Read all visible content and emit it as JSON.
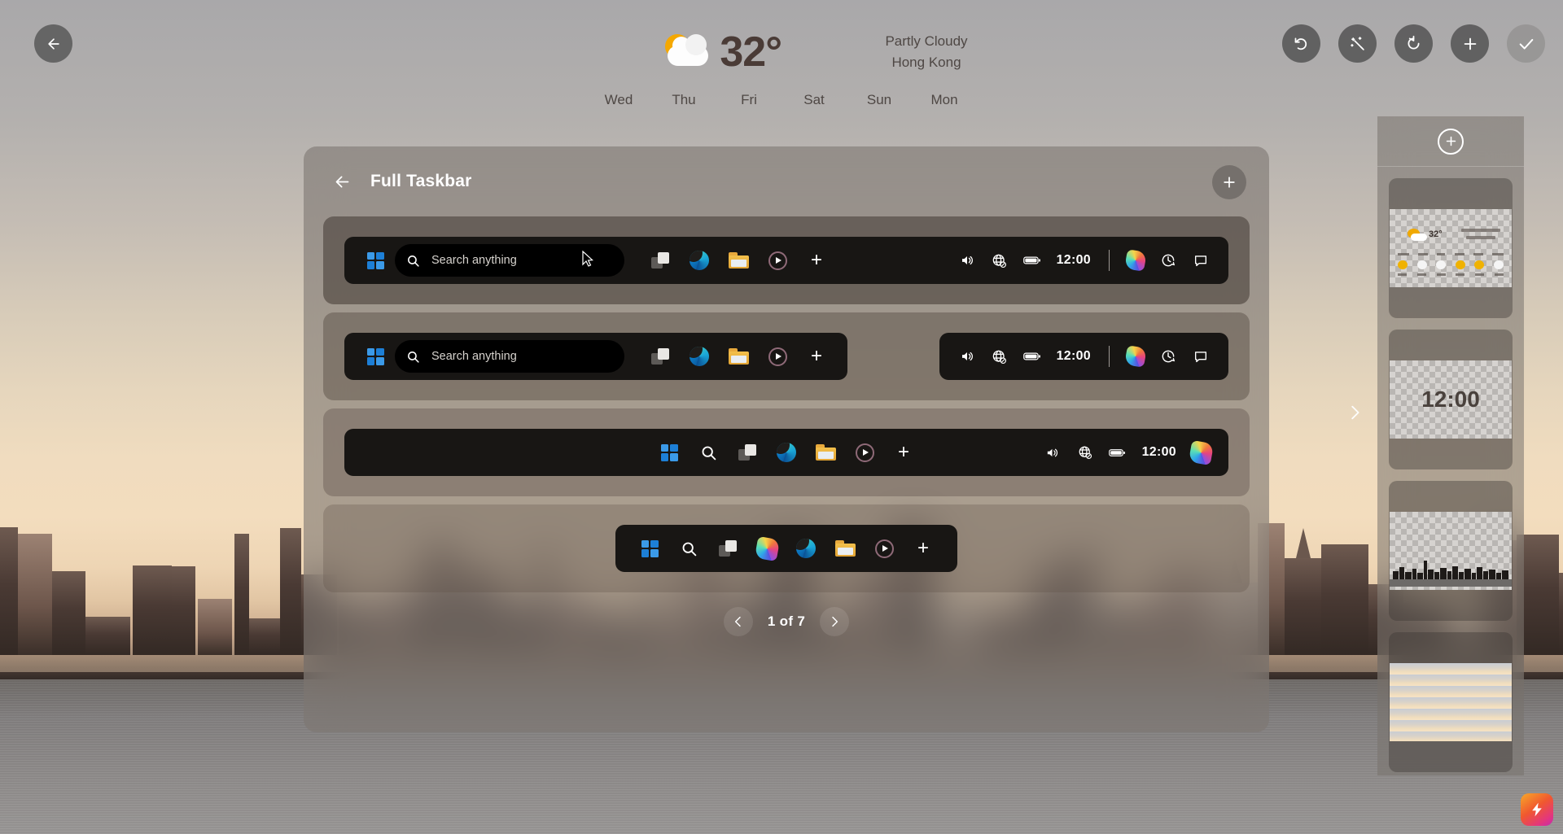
{
  "nav": {
    "back_label": "←",
    "back_name": "back-arrow-icon"
  },
  "toolbar": {
    "undo_label": "↩",
    "magic_label": "✦",
    "reset_label": "↻",
    "add_label": "+",
    "accept_label": "✓"
  },
  "weather": {
    "temperature": "32°",
    "condition": "Partly Cloudy",
    "location": "Hong Kong",
    "days": [
      "Wed",
      "Thu",
      "Fri",
      "Sat",
      "Sun",
      "Mon"
    ]
  },
  "panel": {
    "title": "Full Taskbar",
    "back_label": "←",
    "add_label": "+",
    "pagination": {
      "prev_label": "‹",
      "next_label": "›",
      "label": "1 of 7",
      "current": 1,
      "total": 7
    },
    "rows": [
      {
        "name": "taskbar-variant-full-left-aligned",
        "search_placeholder": "Search anything",
        "time": "12:00",
        "apps": [
          "task-view",
          "edge",
          "file-explorer",
          "media-player",
          "add"
        ],
        "tray": [
          "volume",
          "network",
          "battery"
        ],
        "tray_extra": [
          "copilot",
          "clock-history",
          "chat"
        ]
      },
      {
        "name": "taskbar-variant-split-bars",
        "search_placeholder": "Search anything",
        "time": "12:00",
        "apps": [
          "task-view",
          "edge",
          "file-explorer",
          "media-player",
          "add"
        ],
        "tray": [
          "volume",
          "network",
          "battery"
        ],
        "tray_extra": [
          "copilot",
          "clock-history",
          "chat"
        ]
      },
      {
        "name": "taskbar-variant-centered-compact",
        "time": "12:00",
        "apps": [
          "start",
          "search",
          "task-view",
          "edge",
          "file-explorer",
          "media-player",
          "add"
        ],
        "tray": [
          "volume",
          "network",
          "battery"
        ],
        "tray_extra": [
          "copilot"
        ]
      },
      {
        "name": "taskbar-variant-icons-only",
        "apps": [
          "start",
          "search",
          "task-view",
          "copilot",
          "edge",
          "file-explorer",
          "media-player",
          "add"
        ]
      }
    ]
  },
  "sidebar": {
    "add_label": "+",
    "next_label": "›",
    "items": [
      {
        "name": "layer-weather-widget",
        "kind": "weather",
        "label": ""
      },
      {
        "name": "layer-clock-widget",
        "kind": "clock",
        "label": "12:00"
      },
      {
        "name": "layer-city-skyline",
        "kind": "skyline",
        "label": ""
      },
      {
        "name": "layer-sky-background",
        "kind": "sky",
        "label": ""
      }
    ]
  },
  "badge": {
    "label": "⚡",
    "name": "flash-badge"
  },
  "colors": {
    "accent_blue": "#2d8ce0",
    "folder_yellow": "#f3c04c",
    "temp_text": "#4a3b36",
    "bar_black": "#181614",
    "panel_overlay": "rgba(126,120,115,.62)"
  }
}
